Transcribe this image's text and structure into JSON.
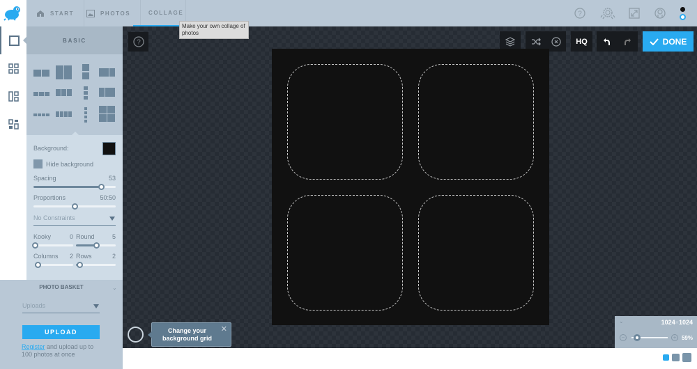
{
  "app": {
    "logo": "frog-logo",
    "nav_tabs": [
      {
        "label": "START",
        "icon": "home-icon",
        "active": false
      },
      {
        "label": "PHOTOS",
        "icon": "image-icon",
        "active": false
      },
      {
        "label": "COLLAGE",
        "icon": "collage-icon",
        "active": true
      }
    ],
    "tooltip": "Make your own collage of photos",
    "top_icons": [
      "help-icon",
      "badge-icon",
      "fullscreen-icon",
      "account-icon"
    ],
    "colors": {
      "accent": "#29aaf0",
      "topbar": "#b9c8d6",
      "panel": "#cfdce7",
      "canvas_bg": "#111111"
    }
  },
  "rail": {
    "items": [
      {
        "name": "basic",
        "icon": "single-square-icon",
        "active": true
      },
      {
        "name": "grid",
        "icon": "grid-icon",
        "active": false
      },
      {
        "name": "freestyle",
        "icon": "layout-icon",
        "active": false
      },
      {
        "name": "templates",
        "icon": "template-icon",
        "active": false
      }
    ]
  },
  "panel": {
    "title": "BASIC",
    "background_label": "Background:",
    "background_color": "#111111",
    "hide_background_label": "Hide background",
    "spacing": {
      "label": "Spacing",
      "value": "53",
      "fraction": 0.82
    },
    "proportions": {
      "label": "Proportions",
      "value": "50:50",
      "fraction": 0.5
    },
    "constraints": {
      "selected": "No Constraints"
    },
    "kooky": {
      "label": "Kooky",
      "value": "0",
      "fraction": 0.0
    },
    "round": {
      "label": "Round",
      "value": "5",
      "fraction": 0.5
    },
    "columns": {
      "label": "Columns",
      "value": "2",
      "fraction": 0.08
    },
    "rows": {
      "label": "Rows",
      "value": "2",
      "fraction": 0.08
    }
  },
  "basket": {
    "title": "PHOTO BASKET",
    "source": "Uploads",
    "upload_label": "UPLOAD",
    "register_link": "Register",
    "register_text": " and upload up to 100 photos at once"
  },
  "toolbar": {
    "hq_label": "HQ",
    "done_label": "DONE"
  },
  "grid_tip": {
    "text": "Change your background grid",
    "close": "✕"
  },
  "zoom": {
    "width": "1024",
    "sep": "×",
    "height": "1024",
    "percent": "59%",
    "fraction": 0.15,
    "minus": "−",
    "plus": "+"
  }
}
